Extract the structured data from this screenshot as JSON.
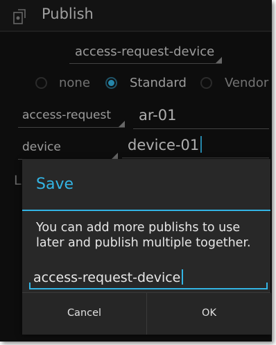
{
  "actionbar": {
    "title": "Publish",
    "icon": "document-icon"
  },
  "publish_spinner": {
    "value": "access-request-device"
  },
  "radios": [
    {
      "label": "none",
      "selected": false
    },
    {
      "label": "Standard",
      "selected": true
    },
    {
      "label": "Vendor",
      "selected": false
    }
  ],
  "row1": {
    "type": "access-request",
    "value": "ar-01"
  },
  "row2": {
    "type": "device",
    "value": "device-01"
  },
  "side_label": "Li",
  "dialog": {
    "title": "Save",
    "message": "You can add more publishs to use later and publish multiple together.",
    "input_value": "access-request-device",
    "cancel_label": "Cancel",
    "ok_label": "OK"
  },
  "colors": {
    "accent": "#33b5e5",
    "background": "#121212",
    "dialog": "#282828"
  }
}
